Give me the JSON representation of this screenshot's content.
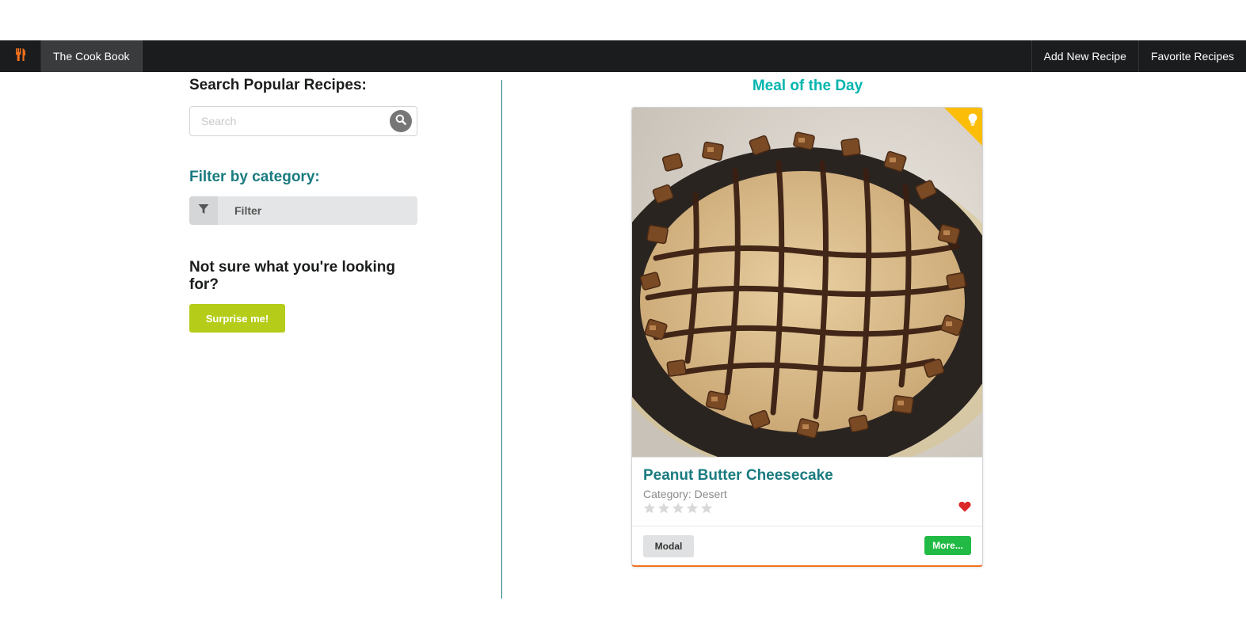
{
  "navbar": {
    "logo_icon": "utensils-icon",
    "brand": "The Cook Book",
    "add_recipe": "Add New Recipe",
    "favorites": "Favorite Recipes"
  },
  "sidebar": {
    "search_title": "Search Popular Recipes:",
    "search_placeholder": "Search",
    "search_value": "",
    "filter_title": "Filter by category:",
    "filter_label": "Filter",
    "notsure_title": "Not sure what you're looking for?",
    "surprise_button": "Surprise me!"
  },
  "meal_of_day": {
    "title": "Meal of the Day",
    "recipe_name": "Peanut Butter Cheesecake",
    "category_text": "Category: Desert",
    "rating": 0,
    "rating_max": 5,
    "favorited": true,
    "modal_button": "Modal",
    "more_button": "More..."
  },
  "colors": {
    "navbar_bg": "#1b1c1d",
    "accent_teal": "#1a7b80",
    "meal_title": "#00b5ad",
    "surprise_olive": "#b5cc18",
    "more_green": "#21ba45",
    "corner_yellow": "#fbbd08",
    "heart_red": "#db2828",
    "logo_orange": "#f2711c"
  }
}
